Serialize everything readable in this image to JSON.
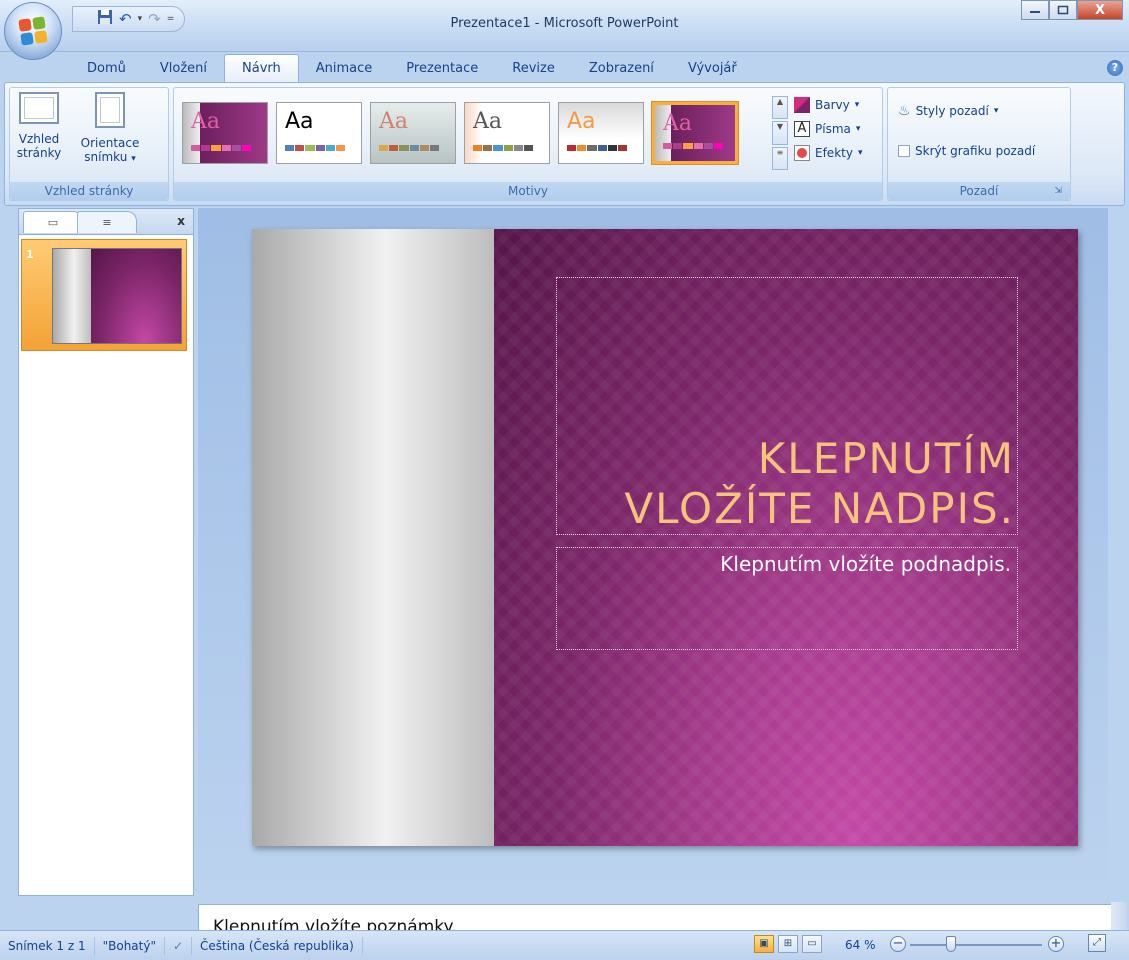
{
  "window": {
    "title": "Prezentace1 - Microsoft PowerPoint",
    "controls": [
      "minimize",
      "maximize",
      "close"
    ],
    "close_glyph": "X"
  },
  "qat": {
    "save_icon": "floppy-icon",
    "undo_glyph": "↶",
    "redo_glyph": "↷",
    "dropdown_glyph": "▾",
    "customize_glyph": "="
  },
  "tabs": [
    {
      "label": "Domů",
      "active": false
    },
    {
      "label": "Vložení",
      "active": false
    },
    {
      "label": "Návrh",
      "active": true
    },
    {
      "label": "Animace",
      "active": false
    },
    {
      "label": "Prezentace",
      "active": false
    },
    {
      "label": "Revize",
      "active": false
    },
    {
      "label": "Zobrazení",
      "active": false
    },
    {
      "label": "Vývojář",
      "active": false
    }
  ],
  "ribbon": {
    "page_setup": {
      "group_label": "Vzhled stránky",
      "btn_page_setup": "Vzhled stránky",
      "btn_orientation": "Orientace snímku"
    },
    "themes": {
      "group_label": "Motivy",
      "sample": "Aa",
      "colors_label": "Barvy",
      "fonts_label": "Písma",
      "effects_label": "Efekty"
    },
    "background": {
      "group_label": "Pozadí",
      "styles_label": "Styly pozadí",
      "hide_graphics_label": "Skrýt grafiku pozadí",
      "hide_graphics_checked": false
    }
  },
  "panel": {
    "close_glyph": "x",
    "slide_number": "1"
  },
  "slide": {
    "title_line1": "KLEPNUTÍM",
    "title_line2": "VLOŽÍTE NADPIS.",
    "subtitle": "Klepnutím vložíte podnadpis."
  },
  "notes": {
    "placeholder": "Klepnutím vložíte poznámky."
  },
  "status": {
    "slide_counter": "Snímek 1 z 1",
    "theme_name": "\"Bohatý\"",
    "language": "Čeština (Česká republika)",
    "zoom": "64 %",
    "zoom_level_fraction": 0.31
  },
  "colors": {
    "accent": "#f6b042",
    "slide_purple": "#7b2568",
    "title_gold": "#f4c47c"
  }
}
